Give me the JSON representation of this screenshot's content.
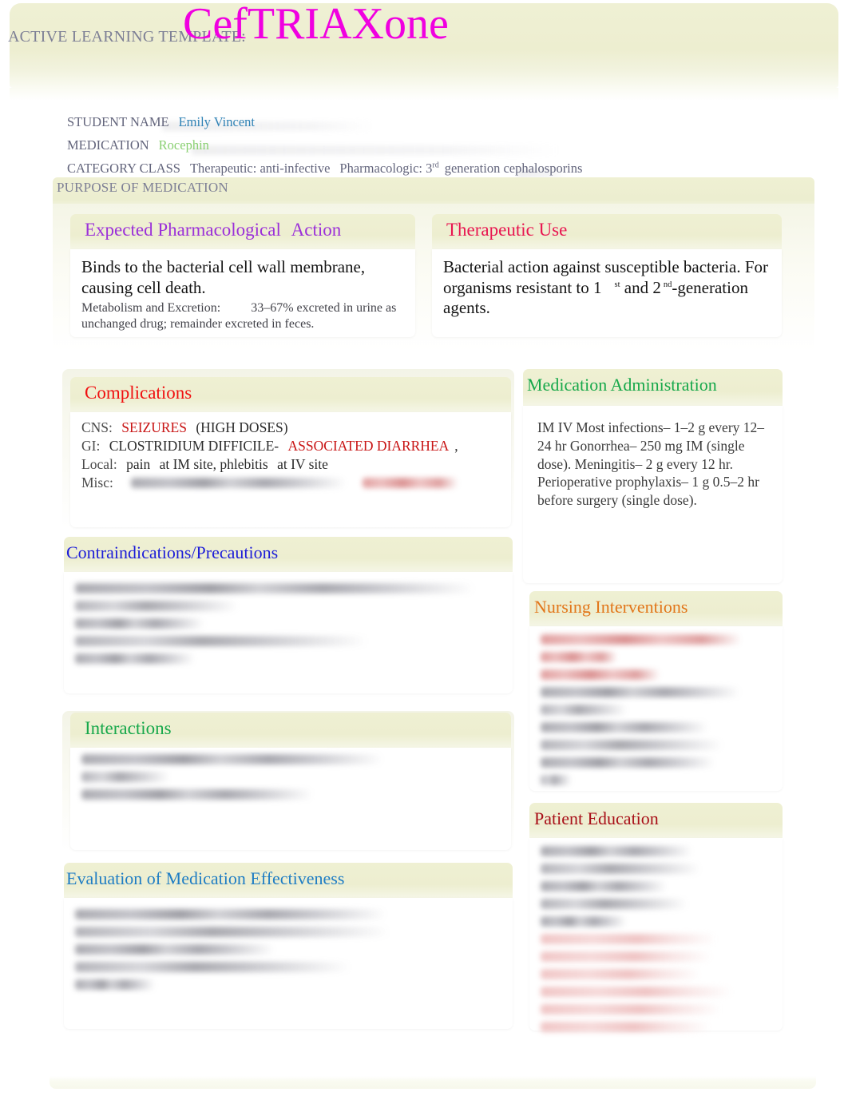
{
  "header": {
    "template_label": "ACTIVE LEARNING TEMPLATE:",
    "drug_title": "CefTRIAXone",
    "title_color": "#f000e0"
  },
  "meta": {
    "student_name_label": "STUDENT NAME",
    "student_name_value": "Emily Vincent",
    "medication_label": "MEDICATION",
    "medication_value": "Rocephin",
    "category_label": "CATEGORY CLASS",
    "category_therapeutic": "Therapeutic: anti-infective",
    "category_pharmacologic_pre": "Pharmacologic: 3",
    "category_pharmacologic_sup": "rd",
    "category_pharmacologic_post": "generation cephalosporins",
    "student_value_color": "#2f82b5",
    "medication_value_color": "#89d071"
  },
  "purpose": {
    "band_label": "PURPOSE OF MEDICATION"
  },
  "expected_action": {
    "title_part1": "Expected Pharmacological",
    "title_part2": "Action",
    "title_color": "#9b30d9",
    "lead": "Binds to the bacterial cell wall membrane, causing cell death.",
    "sub_label": "Metabolism and Excretion:",
    "sub_text": "33–67% excreted in urine as unchanged drug; remainder excreted in feces."
  },
  "therapeutic_use": {
    "title": "Therapeutic Use",
    "title_color": "#e81550",
    "text_a": "Bacterial action against susceptible bacteria. For organisms resistant to 1",
    "sup_a": "st",
    "text_b": "and 2",
    "sup_b": "nd",
    "text_c": "-generation agents."
  },
  "complications": {
    "title": "Complications",
    "title_color": "#f01010",
    "rows": [
      {
        "label": "CNS:",
        "highlight": "SEIZURES",
        "tail": "(HIGH DOSES)"
      },
      {
        "label": "GI:",
        "plain": "CLOSTRIDIUM DIFFICILE-",
        "highlight": "ASSOCIATED DIARRHEA",
        "tail": ","
      },
      {
        "label": "Local:",
        "plain": "pain",
        "bold1": "at IM site",
        "mid": ", phlebitis",
        "bold2": "at IV site"
      },
      {
        "label": "Misc:",
        "redacted": true
      }
    ]
  },
  "medication_administration": {
    "title": "Medication Administration",
    "title_color": "#17a84b",
    "text": "IM  IV  Most infections–   1–2 g every 12–24 hr   Gonorrhea–   250 mg IM (single dose).   Meningitis–  2 g every 12 hr.  Perioperative prophylaxis–    1 g 0.5–2 hr before surgery (single dose)."
  },
  "contraindications": {
    "title": "Contraindications/Precautions",
    "title_color": "#1d1dd8",
    "redacted": true,
    "redacted_lines": 5
  },
  "interactions": {
    "title": "Interactions",
    "title_color": "#17a84b",
    "redacted": true,
    "redacted_lines": 3
  },
  "evaluation": {
    "title": "Evaluation of Medication Effectiveness",
    "title_color": "#1f7dc4",
    "redacted": true,
    "redacted_lines": 5
  },
  "nursing_interventions": {
    "title": "Nursing Interventions",
    "title_color": "#e2761a",
    "redacted": true,
    "redacted_lines_red": 3,
    "redacted_lines_grey": 6
  },
  "patient_education": {
    "title": "Patient Education",
    "title_color": "#a80f18",
    "redacted": true,
    "redacted_lines_grey": 5,
    "redacted_lines_pink": 6
  }
}
